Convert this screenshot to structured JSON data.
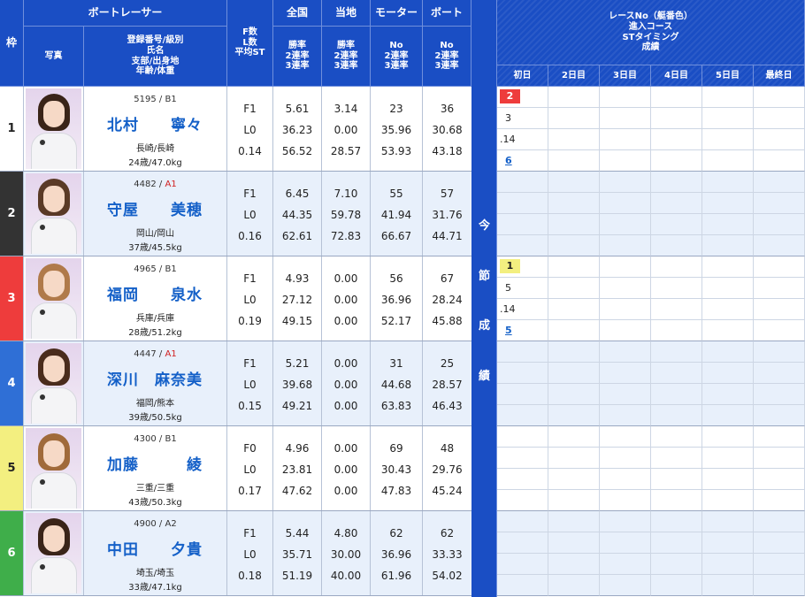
{
  "header": {
    "waku": "枠",
    "racer": "ボートレーサー",
    "photo": "写真",
    "info_lines": [
      "登録番号/級別",
      "氏名",
      "支部/出身地",
      "年齢/体重"
    ],
    "f_lines": [
      "F数",
      "L数",
      "平均ST"
    ],
    "zenkoku": "全国",
    "touchi": "当地",
    "motor": "モーター",
    "boat": "ボート",
    "rate_lines": [
      "勝率",
      "2連率",
      "3連率"
    ],
    "no_lines": [
      "No",
      "2連率",
      "3連率"
    ],
    "session_lines": [
      "レースNo（艇番色）",
      "進入コース",
      "STタイミング",
      "成績"
    ],
    "days": [
      "初日",
      "2日目",
      "3日目",
      "4日目",
      "5日目",
      "最終日"
    ],
    "vertical_label": [
      "今",
      "節",
      "成",
      "績"
    ]
  },
  "racers": [
    {
      "frame": "1",
      "reg": "5195",
      "cls": "B1",
      "last": "北村",
      "first": "寧々",
      "branch": "長崎/長崎",
      "age_weight": "24歳/47.0kg",
      "f": [
        "F1",
        "L0",
        "0.14"
      ],
      "all": [
        "5.61",
        "36.23",
        "56.52"
      ],
      "local": [
        "3.14",
        "0.00",
        "28.57"
      ],
      "motor": [
        "23",
        "35.96",
        "53.93"
      ],
      "boat": [
        "36",
        "30.68",
        "43.18"
      ],
      "hair": "#3a2418",
      "frame_bg": "#ffffff",
      "frame_fg": "#222222",
      "session": {
        "race": "2",
        "color": "red",
        "course": "3",
        "st": ".14",
        "result": "6"
      }
    },
    {
      "frame": "2",
      "reg": "4482",
      "cls": "A1",
      "last": "守屋",
      "first": "美穂",
      "branch": "岡山/岡山",
      "age_weight": "37歳/45.5kg",
      "f": [
        "F1",
        "L0",
        "0.16"
      ],
      "all": [
        "6.45",
        "44.35",
        "62.61"
      ],
      "local": [
        "7.10",
        "59.78",
        "72.83"
      ],
      "motor": [
        "55",
        "41.94",
        "66.67"
      ],
      "boat": [
        "57",
        "31.76",
        "44.71"
      ],
      "hair": "#5a3a26",
      "frame_bg": "#333333",
      "frame_fg": "#ffffff",
      "session": null
    },
    {
      "frame": "3",
      "reg": "4965",
      "cls": "B1",
      "last": "福岡",
      "first": "泉水",
      "branch": "兵庫/兵庫",
      "age_weight": "28歳/51.2kg",
      "f": [
        "F1",
        "L0",
        "0.19"
      ],
      "all": [
        "4.93",
        "27.12",
        "49.15"
      ],
      "local": [
        "0.00",
        "0.00",
        "0.00"
      ],
      "motor": [
        "56",
        "36.96",
        "52.17"
      ],
      "boat": [
        "67",
        "28.24",
        "45.88"
      ],
      "hair": "#b07a4a",
      "frame_bg": "#ee3c3c",
      "frame_fg": "#ffffff",
      "session": {
        "race": "1",
        "color": "yellow",
        "course": "5",
        "st": ".14",
        "result": "5"
      }
    },
    {
      "frame": "4",
      "reg": "4447",
      "cls": "A1",
      "last": "深川",
      "first": "麻奈美",
      "branch": "福岡/熊本",
      "age_weight": "39歳/50.5kg",
      "f": [
        "F1",
        "L0",
        "0.15"
      ],
      "all": [
        "5.21",
        "39.68",
        "49.21"
      ],
      "local": [
        "0.00",
        "0.00",
        "0.00"
      ],
      "motor": [
        "31",
        "44.68",
        "63.83"
      ],
      "boat": [
        "25",
        "28.57",
        "46.43"
      ],
      "hair": "#4a2c1c",
      "frame_bg": "#2f6fd6",
      "frame_fg": "#ffffff",
      "session": null
    },
    {
      "frame": "5",
      "reg": "4300",
      "cls": "B1",
      "last": "加藤",
      "first": "綾",
      "branch": "三重/三重",
      "age_weight": "43歳/50.3kg",
      "f": [
        "F0",
        "L0",
        "0.17"
      ],
      "all": [
        "4.96",
        "23.81",
        "47.62"
      ],
      "local": [
        "0.00",
        "0.00",
        "0.00"
      ],
      "motor": [
        "69",
        "30.43",
        "47.83"
      ],
      "boat": [
        "48",
        "29.76",
        "45.24"
      ],
      "hair": "#a06a3a",
      "frame_bg": "#f3ef80",
      "frame_fg": "#222222",
      "session": null
    },
    {
      "frame": "6",
      "reg": "4900",
      "cls": "A2",
      "last": "中田",
      "first": "夕貴",
      "branch": "埼玉/埼玉",
      "age_weight": "33歳/47.1kg",
      "f": [
        "F1",
        "L0",
        "0.18"
      ],
      "all": [
        "5.44",
        "35.71",
        "51.19"
      ],
      "local": [
        "4.80",
        "30.00",
        "40.00"
      ],
      "motor": [
        "62",
        "36.96",
        "61.96"
      ],
      "boat": [
        "62",
        "33.33",
        "54.02"
      ],
      "hair": "#3a2418",
      "frame_bg": "#3fae4a",
      "frame_fg": "#ffffff",
      "session": null
    }
  ]
}
